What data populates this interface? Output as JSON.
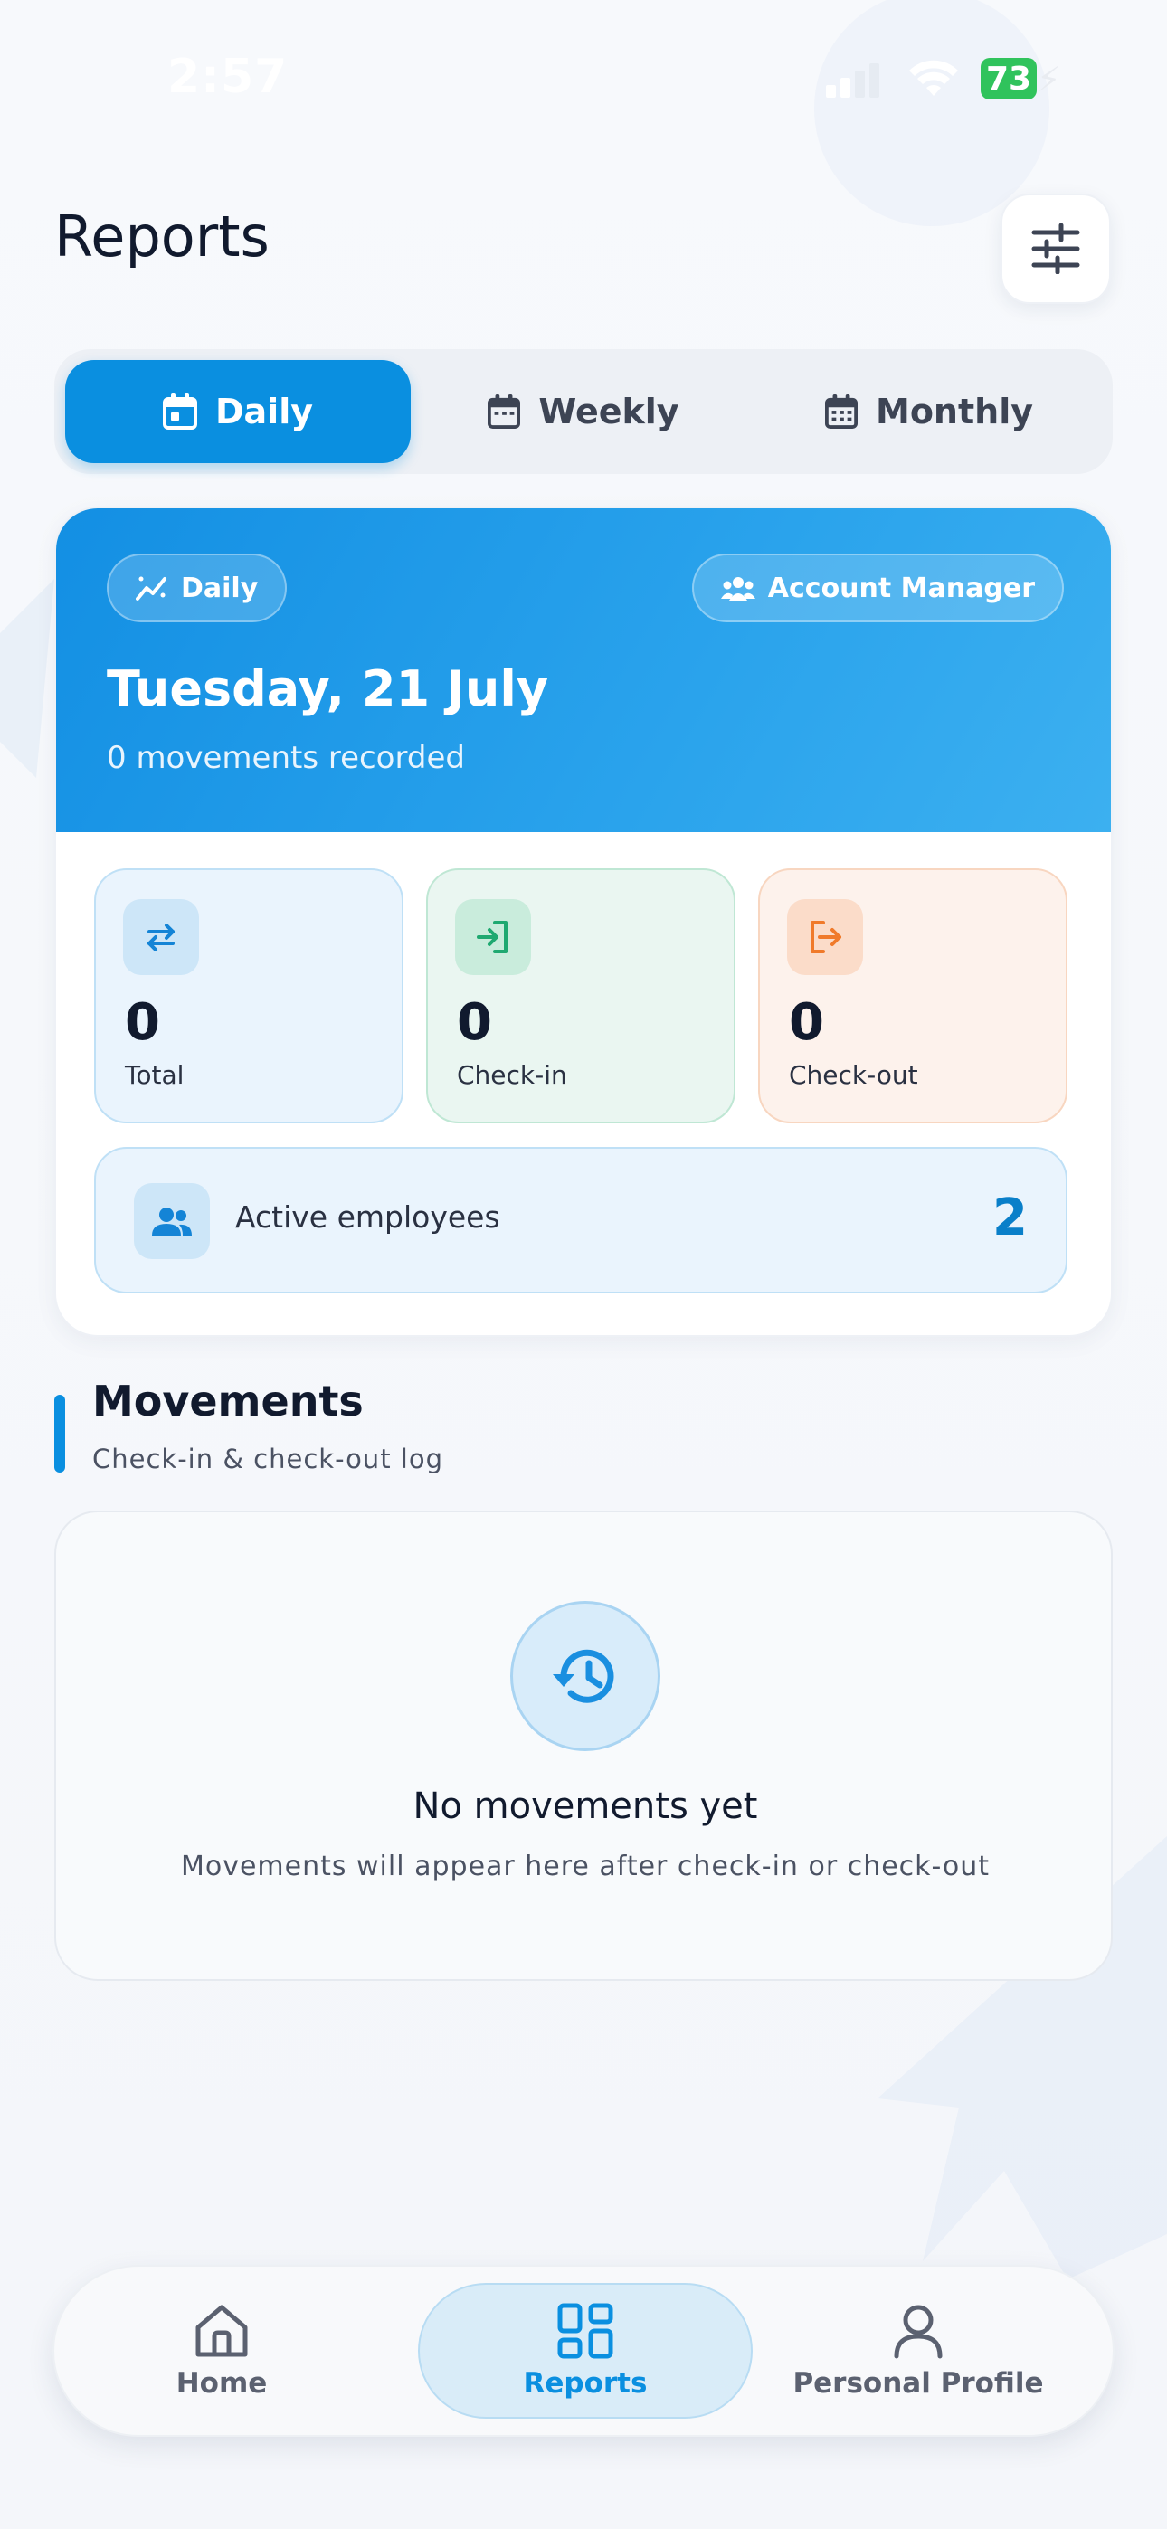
{
  "status_bar": {
    "time": "2:57",
    "battery": "73"
  },
  "header": {
    "title": "Reports",
    "filter_icon": "sliders-icon"
  },
  "tabs": [
    {
      "label": "Daily",
      "icon": "calendar-icon",
      "active": true
    },
    {
      "label": "Weekly",
      "icon": "calendar-icon",
      "active": false
    },
    {
      "label": "Monthly",
      "icon": "calendar-icon",
      "active": false
    }
  ],
  "summary": {
    "period_chip": "Daily",
    "role_chip": "Account Manager",
    "date": "Tuesday, 21 July",
    "subtitle": "0 movements recorded",
    "stats": {
      "total": {
        "value": "0",
        "label": "Total"
      },
      "checkin": {
        "value": "0",
        "label": "Check-in"
      },
      "checkout": {
        "value": "0",
        "label": "Check-out"
      }
    },
    "active_employees": {
      "label": "Active employees",
      "count": "2"
    }
  },
  "movements": {
    "title": "Movements",
    "subtitle": "Check-in & check-out log",
    "empty_title": "No movements yet",
    "empty_message": "Movements will appear here after check-in or check-out"
  },
  "bottom_nav": [
    {
      "label": "Home",
      "icon": "home-icon",
      "active": false
    },
    {
      "label": "Reports",
      "icon": "grid-icon",
      "active": true
    },
    {
      "label": "Personal Profile",
      "icon": "person-icon",
      "active": false
    }
  ],
  "colors": {
    "accent": "#0a8fe0",
    "checkin": "#1fa971",
    "checkout": "#f07a2a"
  }
}
